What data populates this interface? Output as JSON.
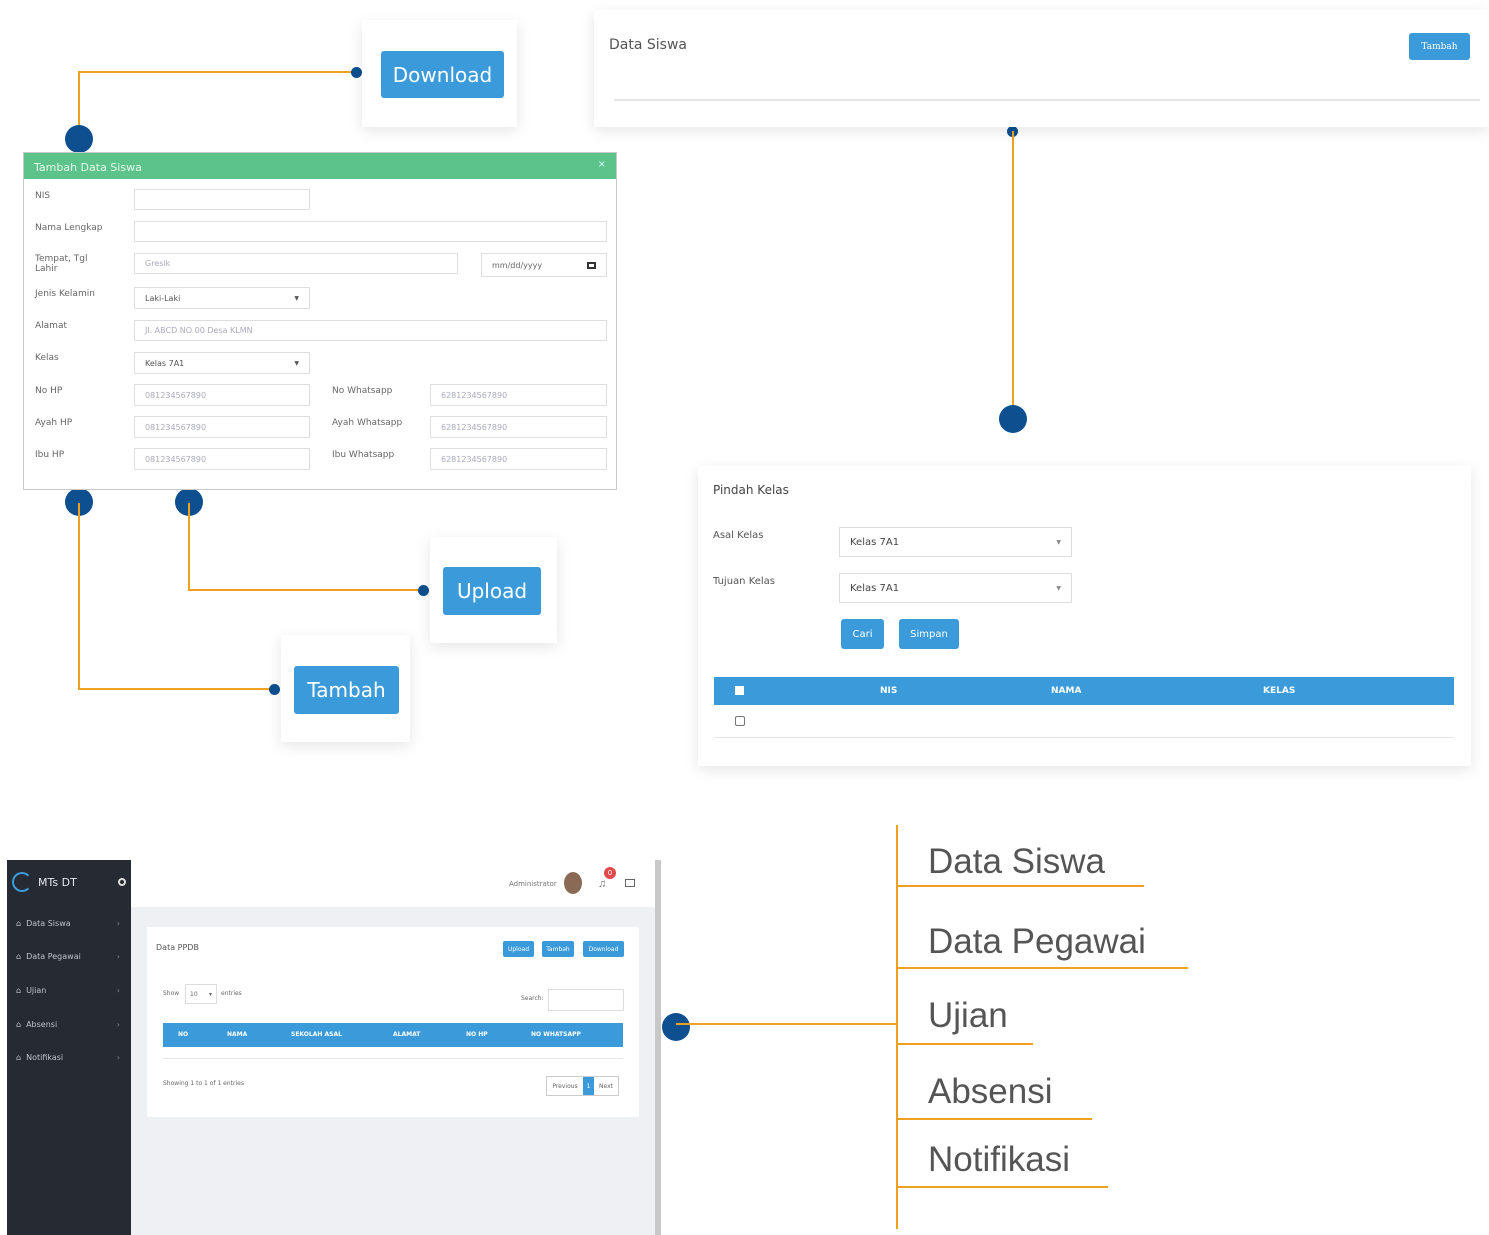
{
  "callouts": {
    "download": "Download",
    "upload": "Upload",
    "tambah": "Tambah"
  },
  "modal": {
    "title": "Tambah Data Siswa",
    "close": "×",
    "fields": {
      "nis": "NIS",
      "nama": "Nama Lengkap",
      "ttl": "Tempat, Tgl Lahir",
      "ttl_place_ph": "Gresik",
      "ttl_date_ph": "mm/dd/yyyy",
      "jk": "Jenis Kelamin",
      "jk_value": "Laki-Laki",
      "alamat": "Alamat",
      "alamat_ph": "Jl. ABCD NO 00 Desa KLMN",
      "kelas": "Kelas",
      "kelas_value": "Kelas 7A1",
      "nohp": "No HP",
      "nohp_ph": "081234567890",
      "nowa": "No Whatsapp",
      "nowa_ph": "6281234567890",
      "ayahhp": "Ayah HP",
      "ayahhp_ph": "081234567890",
      "ayahwa": "Ayah Whatsapp",
      "ayahwa_ph": "6281234567890",
      "ibuhp": "Ibu HP",
      "ibuhp_ph": "081234567890",
      "ibuwa": "Ibu Whatsapp",
      "ibuwa_ph": "6281234567890"
    }
  },
  "data_siswa": {
    "title": "Data Siswa",
    "tambah": "Tambah"
  },
  "pindah_kelas": {
    "title": "Pindah Kelas",
    "asal_label": "Asal Kelas",
    "asal_value": "Kelas 7A1",
    "tujuan_label": "Tujuan Kelas",
    "tujuan_value": "Kelas 7A1",
    "cari": "Cari",
    "simpan": "Simpan",
    "headers": [
      "NIS",
      "NAMA",
      "KELAS"
    ]
  },
  "dashboard": {
    "brand": "MTs DT",
    "admin": "Administrator",
    "notif_count": "0",
    "sidebar": [
      "Data Siswa",
      "Data Pegawai",
      "Ujian",
      "Absensi",
      "Notifikasi"
    ],
    "panel_title": "Data PPDB",
    "buttons": [
      "Upload",
      "Tambah",
      "Download"
    ],
    "show_label": "Show",
    "show_value": "10",
    "entries_label": "entries",
    "search_label": "Search:",
    "columns": [
      "NO",
      "NAMA",
      "SEKOLAH ASAL",
      "ALAMAT",
      "NO HP",
      "NO WHATSAPP"
    ],
    "showing": "Showing 1 to 1 of 1 entries",
    "pagination": [
      "Previous",
      "1",
      "Next"
    ]
  },
  "menu": [
    "Data Siswa",
    "Data Pegawai",
    "Ujian",
    "Absensi",
    "Notifikasi"
  ],
  "colors": {
    "accent_line": "#f0a020",
    "dot": "#0d4f8f",
    "button": "#3b9ad9",
    "modal_header": "#5cc38b",
    "sidebar": "#262a33"
  }
}
